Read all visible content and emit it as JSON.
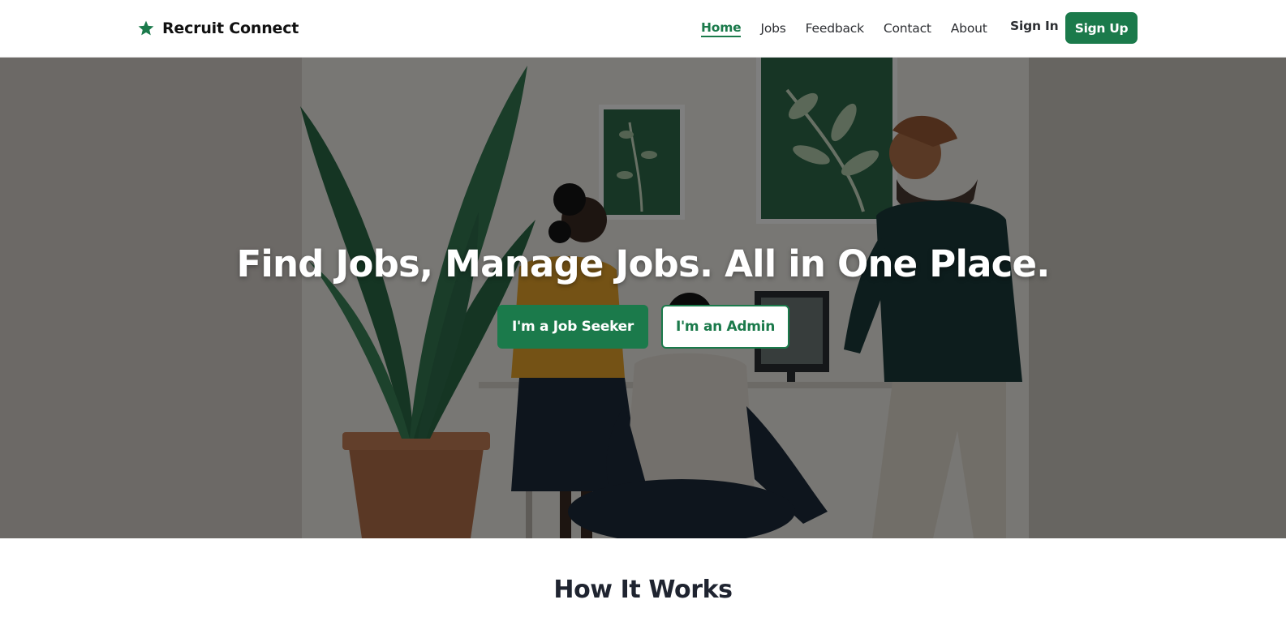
{
  "brand": {
    "name": "Recruit Connect",
    "icon": "star-icon",
    "color": "#1b7a4b"
  },
  "nav": {
    "links": [
      {
        "label": "Home",
        "active": true
      },
      {
        "label": "Jobs",
        "active": false
      },
      {
        "label": "Feedback",
        "active": false
      },
      {
        "label": "Contact",
        "active": false
      },
      {
        "label": "About",
        "active": false
      }
    ],
    "signin_label": "Sign In",
    "signup_label": "Sign Up"
  },
  "hero": {
    "title": "Find Jobs, Manage Jobs. All in One Place.",
    "seeker_button": "I'm a Job Seeker",
    "admin_button": "I'm an Admin"
  },
  "section": {
    "how_title": "How It Works"
  },
  "colors": {
    "accent": "#1b7a4b",
    "text_dark": "#1f2430",
    "overlay": "rgba(0,0,0,0.5)"
  }
}
